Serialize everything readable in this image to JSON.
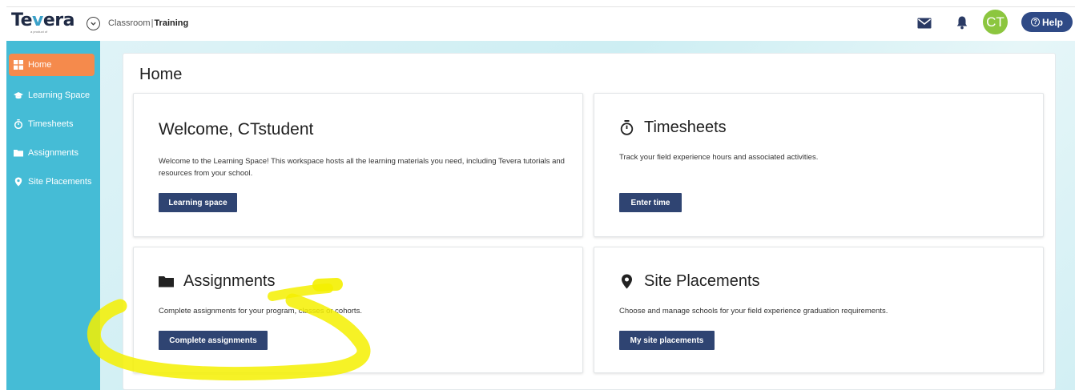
{
  "header": {
    "logo_text_a": "Te",
    "logo_text_v": "v",
    "logo_text_b": "era",
    "logo_subtext": "a product of",
    "breadcrumb_context": "Classroom",
    "breadcrumb_separator": "|",
    "breadcrumb_current": "Training",
    "avatar_initials": "CT",
    "help_label": "Help",
    "help_glyph": "?"
  },
  "sidebar": {
    "items": [
      {
        "label": "Home",
        "icon": "grid-icon",
        "active": true
      },
      {
        "label": "Learning Space",
        "icon": "graduation-cap-icon",
        "active": false
      },
      {
        "label": "Timesheets",
        "icon": "stopwatch-icon",
        "active": false
      },
      {
        "label": "Assignments",
        "icon": "folder-icon",
        "active": false
      },
      {
        "label": "Site Placements",
        "icon": "map-pin-icon",
        "active": false
      }
    ]
  },
  "main": {
    "title": "Home",
    "cards": {
      "welcome": {
        "title": "Welcome, CTstudent",
        "description": "Welcome to the Learning Space! This workspace hosts all the learning materials you need, including Tevera tutorials and resources from your school.",
        "button": "Learning space"
      },
      "timesheets": {
        "title": "Timesheets",
        "icon": "stopwatch-icon",
        "description": "Track your field experience hours and associated activities.",
        "button": "Enter time"
      },
      "assignments": {
        "title": "Assignments",
        "icon": "folder-icon",
        "description": "Complete assignments for your program, classes or cohorts.",
        "button": "Complete assignments"
      },
      "site_placements": {
        "title": "Site Placements",
        "icon": "map-pin-icon",
        "description": "Choose and manage schools for your field experience graduation requirements.",
        "button": "My site placements"
      }
    }
  },
  "colors": {
    "sidebar": "#45bcd6",
    "active_nav": "#f58a4c",
    "button": "#2f4472",
    "help_button": "#2f4a86",
    "avatar": "#8cc63f",
    "highlighter": "#f4f000"
  }
}
